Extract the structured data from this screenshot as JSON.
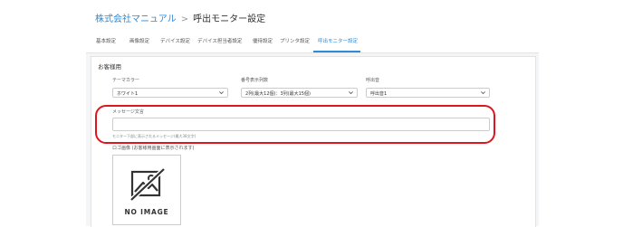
{
  "breadcrumb": {
    "company": "株式会社マニュアル",
    "separator": ">",
    "current": "呼出モニター設定"
  },
  "tabs": [
    {
      "label": "基本設定"
    },
    {
      "label": "画像設定"
    },
    {
      "label": "デバイス設定"
    },
    {
      "label": "デバイス担当者設定"
    },
    {
      "label": "優待設定"
    },
    {
      "label": "プリンタ設定"
    },
    {
      "label": "呼出モニター設定"
    }
  ],
  "active_tab": "呼出モニター設定",
  "section": {
    "title": "お客様用"
  },
  "fields": {
    "theme": {
      "label": "テーマカラー",
      "value": "ホワイト1"
    },
    "number_display": {
      "label": "番号表示列数",
      "value": "2列(最大12個)：3列(最大15個)"
    },
    "call_sound": {
      "label": "呼出音",
      "value": "呼出音1"
    },
    "message": {
      "label": "メッセージ文言",
      "value": "",
      "hint": "モニター下部に表示されるメッセージ(最大38文字)"
    },
    "logo": {
      "label": "ロゴ画像 (お客様用画面に表示されます)",
      "placeholder_text": "NO IMAGE"
    }
  },
  "colors": {
    "accent": "#2f8bd6",
    "highlight": "#e0151d"
  }
}
